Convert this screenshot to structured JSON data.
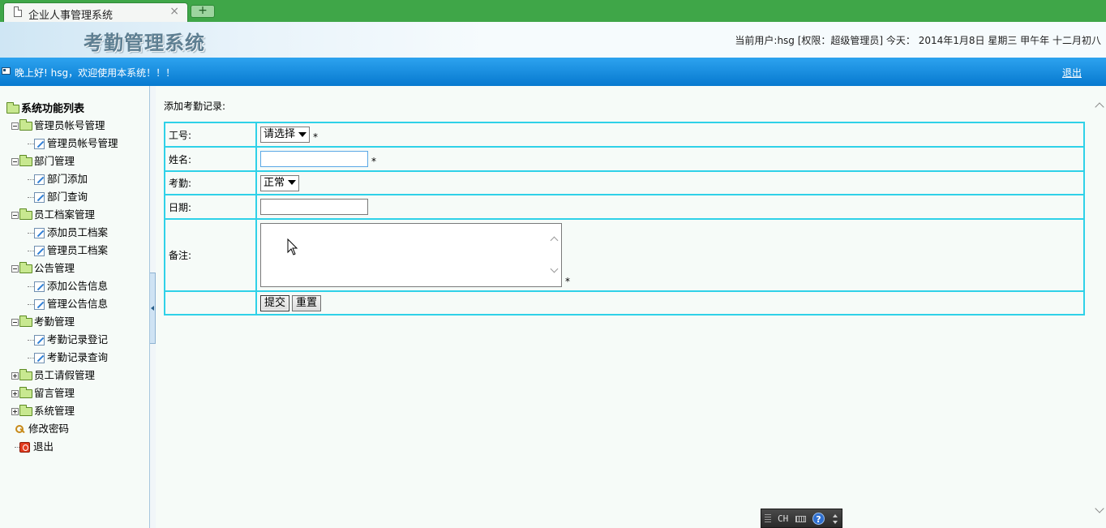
{
  "browser": {
    "tab_title": "企业人事管理系统",
    "close_glyph": "×",
    "new_tab_glyph": "+"
  },
  "header": {
    "system_title": "考勤管理系统",
    "user_info": "当前用户:hsg [权限：超级管理员] 今天： 2014年1月8日 星期三 甲午年 十二月初八"
  },
  "banner": {
    "welcome": "晚上好! hsg，欢迎使用本系统！！！",
    "logout": "退出"
  },
  "sidebar": {
    "root": "系统功能列表",
    "groups": [
      {
        "label": "管理员帐号管理",
        "expanded": true,
        "items": [
          "管理员帐号管理"
        ]
      },
      {
        "label": "部门管理",
        "expanded": true,
        "items": [
          "部门添加",
          "部门查询"
        ]
      },
      {
        "label": "员工档案管理",
        "expanded": true,
        "items": [
          "添加员工档案",
          "管理员工档案"
        ]
      },
      {
        "label": "公告管理",
        "expanded": true,
        "items": [
          "添加公告信息",
          "管理公告信息"
        ]
      },
      {
        "label": "考勤管理",
        "expanded": true,
        "items": [
          "考勤记录登记",
          "考勤记录查询"
        ]
      },
      {
        "label": "员工请假管理",
        "expanded": false,
        "items": []
      },
      {
        "label": "留言管理",
        "expanded": false,
        "items": []
      },
      {
        "label": "系统管理",
        "expanded": false,
        "items": []
      }
    ],
    "change_password": "修改密码",
    "exit": "退出"
  },
  "form": {
    "section_title": "添加考勤记录:",
    "employee_id_label": "工号:",
    "employee_id_select": "请选择",
    "name_label": "姓名:",
    "name_value": "",
    "attendance_label": "考勤:",
    "attendance_select": "正常",
    "date_label": "日期:",
    "date_value": "",
    "remark_label": "备注:",
    "remark_value": "",
    "required_mark": "*",
    "submit_label": "提交",
    "reset_label": "重置"
  },
  "ime": {
    "lang": "CH",
    "help": "?"
  },
  "colors": {
    "tabbar": "#3fa648",
    "banner": "#0a86dd",
    "table_border": "#2fd1e8"
  }
}
